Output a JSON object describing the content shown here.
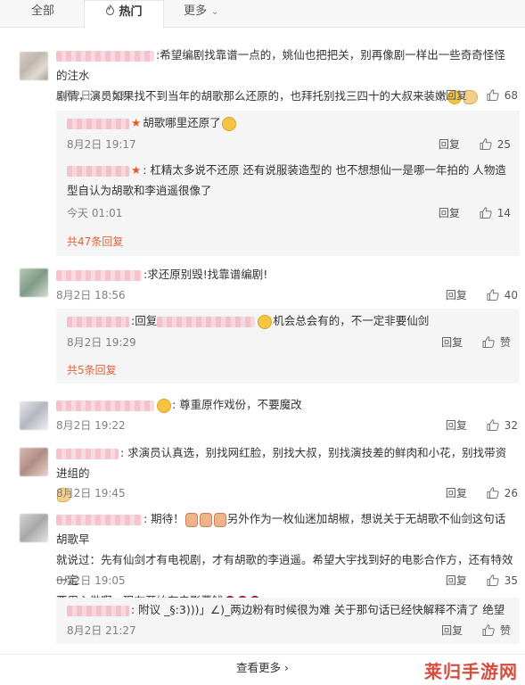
{
  "tabs": {
    "all": "全部",
    "hot": "热门",
    "more": "更多"
  },
  "labels": {
    "reply": "回复",
    "like": "赞"
  },
  "comments": [
    {
      "text_a": ":希望编剧找靠谱一点的，姚仙也把把关，别再像剧一样出一些奇奇怪怪的注水",
      "text_b": "剧情，演员如果找不到当年的胡歌那么还原的，也拜托别找三四十的大叔来装嫩",
      "time": "8月2日 18:58",
      "likes": "68",
      "replies": [
        {
          "text": "胡歌哪里还原了",
          "time": "8月2日 19:17",
          "likes": "25"
        },
        {
          "text_a": ": 杠精太多说不还原 还有说服装造型的 也不想想仙一是哪一年拍的 人物造",
          "text_b": "型自认为胡歌和李逍遥很像了",
          "time": "今天 01:01",
          "likes": "14"
        }
      ],
      "more_replies": "共47条回复"
    },
    {
      "text": ":求还原别毁!找靠谱编剧!",
      "time": "8月2日 18:56",
      "likes": "40",
      "replies": [
        {
          "text_a": ":回复",
          "text_b": "机会总会有的，不一定非要仙剑",
          "time": "8月2日 19:29",
          "likes": "赞"
        }
      ],
      "more_replies": "共5条回复"
    },
    {
      "text": ": 尊重原作戏份，不要魔改",
      "time": "8月2日 19:22",
      "likes": "32"
    },
    {
      "text": ": 求演员认真选，别找网红脸，别找大叔，别找演技差的鲜肉和小花，别找带资进组的",
      "time": "8月2日 19:45",
      "likes": "26"
    },
    {
      "text_a": ": 期待！",
      "text_b": "另外作为一枚仙迷加胡椒，想说关于无胡歌不仙剑这句话胡歌早",
      "text_c": "就说过：先有仙剑才有电视剧，才有胡歌的李逍遥。希望大宇找到好的电影合作方，还有特效一定",
      "text_d": "要用心做啊，现在开始存电影票钱",
      "time": "8月2日 19:05",
      "likes": "35",
      "replies": [
        {
          "text": ": 附议 _§:3)))」∠)_两边粉有时候很为难 关于那句话已经快解释不清了 绝望",
          "time": "8月2日 21:27",
          "likes": "赞"
        }
      ]
    }
  ],
  "see_more": "查看更多",
  "watermark": "莱归手游网"
}
